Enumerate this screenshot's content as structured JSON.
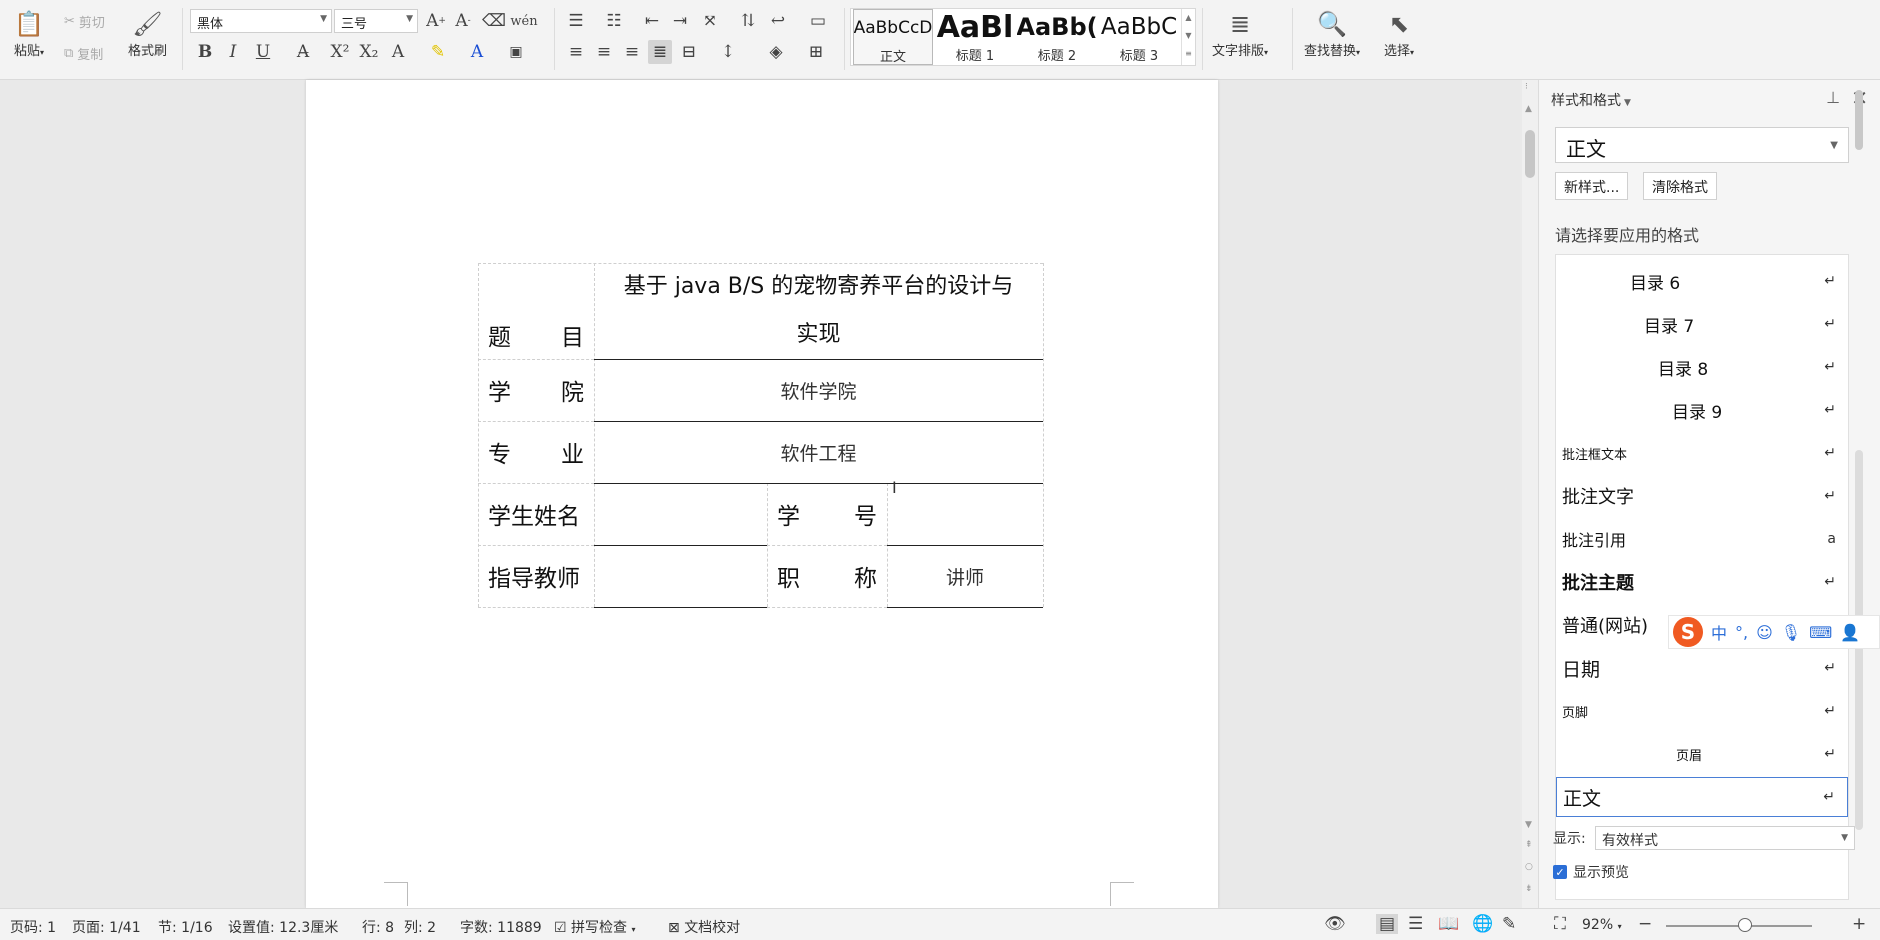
{
  "ribbon": {
    "paste_label": "粘贴",
    "cut_label": "剪切",
    "copy_label": "复制",
    "format_painter_label": "格式刷",
    "font_name": "黑体",
    "font_size": "三号",
    "bold": "B",
    "italic": "I",
    "underline": "U",
    "styles": [
      {
        "sample": "AaBbCcD",
        "name": "正文"
      },
      {
        "sample": "AaBl",
        "name": "标题 1"
      },
      {
        "sample": "AaBb(",
        "name": "标题 2"
      },
      {
        "sample": "AaBbC",
        "name": "标题 3"
      }
    ],
    "text_layout_label": "文字排版",
    "find_replace_label": "查找替换",
    "select_label": "选择"
  },
  "document": {
    "table": {
      "title_label_chars": [
        "题",
        "目"
      ],
      "title_line1": "基于 java B/S 的宠物寄养平台的设计与",
      "title_line2": "实现",
      "college_label_chars": [
        "学",
        "院"
      ],
      "college_value": "软件学院",
      "major_label_chars": [
        "专",
        "业"
      ],
      "major_value": "软件工程",
      "student_name_label": "学生姓名",
      "student_name_value": "",
      "student_id_label_chars": [
        "学",
        "号"
      ],
      "student_id_value": "",
      "advisor_label": "指导教师",
      "advisor_value": "",
      "title_rank_label_chars": [
        "职",
        "称"
      ],
      "title_rank_value": "讲师"
    }
  },
  "pane": {
    "title": "样式和格式",
    "current_style": "正文",
    "new_style_btn": "新样式...",
    "clear_format_btn": "清除格式",
    "apply_prompt": "请选择要应用的格式",
    "style_items": [
      {
        "label": "目录 6",
        "indent": 74,
        "size": 17,
        "bold": false,
        "mark": "↵"
      },
      {
        "label": "目录 7",
        "indent": 88,
        "size": 17,
        "bold": false,
        "mark": "↵"
      },
      {
        "label": "目录 8",
        "indent": 102,
        "size": 17,
        "bold": false,
        "mark": "↵"
      },
      {
        "label": "目录 9",
        "indent": 116,
        "size": 17,
        "bold": false,
        "mark": "↵"
      },
      {
        "label": "批注框文本",
        "indent": 6,
        "size": 13,
        "bold": false,
        "mark": "↵"
      },
      {
        "label": "批注文字",
        "indent": 6,
        "size": 18,
        "bold": false,
        "mark": "↵"
      },
      {
        "label": "批注引用",
        "indent": 6,
        "size": 16,
        "bold": false,
        "mark": "a"
      },
      {
        "label": "批注主题",
        "indent": 6,
        "size": 18,
        "bold": true,
        "mark": "↵"
      },
      {
        "label": "普通(网站)",
        "indent": 6,
        "size": 18,
        "bold": false,
        "mark": "↵"
      },
      {
        "label": "日期",
        "indent": 6,
        "size": 19,
        "bold": false,
        "mark": "↵"
      },
      {
        "label": "页脚",
        "indent": 6,
        "size": 13,
        "bold": false,
        "mark": "↵"
      },
      {
        "label": "页眉",
        "indent": 120,
        "size": 13,
        "bold": false,
        "mark": "↵"
      },
      {
        "label": "正文",
        "indent": 6,
        "size": 19,
        "bold": false,
        "mark": "↵"
      }
    ],
    "show_label": "显示:",
    "show_value": "有效样式",
    "preview_label": "显示预览"
  },
  "ime": {
    "logo": "S",
    "mode": "中",
    "punct": "°,"
  },
  "status": {
    "page_code": "页码: 1",
    "page": "页面: 1/41",
    "section": "节: 1/16",
    "setting": "设置值: 12.3厘米",
    "row": "行: 8",
    "col": "列: 2",
    "word_count": "字数: 11889",
    "spell_check": "拼写检查",
    "doc_proof": "文档校对",
    "zoom": "92%"
  }
}
